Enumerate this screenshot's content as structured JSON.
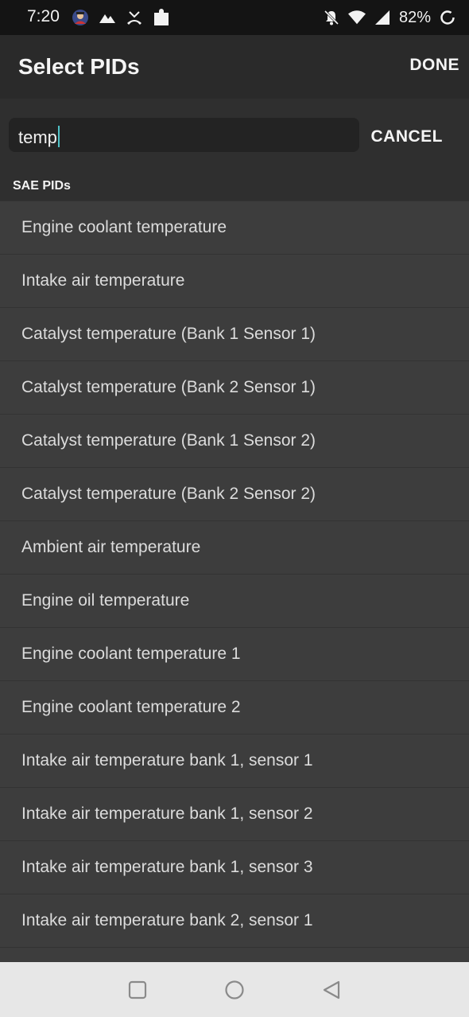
{
  "status_bar": {
    "time": "7:20",
    "battery": "82%",
    "icons_left": [
      "avatar-icon",
      "mountain-icon",
      "missed-call-icon",
      "puzzle-icon"
    ],
    "icons_right": [
      "mute-icon",
      "wifi-icon",
      "signal-icon",
      "battery-ring-icon"
    ]
  },
  "toolbar": {
    "title": "Select PIDs",
    "done_label": "DONE"
  },
  "search": {
    "value": "temp",
    "cancel_label": "CANCEL"
  },
  "section": {
    "header": "SAE PIDs"
  },
  "items": [
    {
      "label": "Engine coolant temperature"
    },
    {
      "label": "Intake air temperature"
    },
    {
      "label": "Catalyst temperature (Bank 1 Sensor 1)"
    },
    {
      "label": "Catalyst temperature (Bank 2 Sensor 1)"
    },
    {
      "label": "Catalyst temperature (Bank 1 Sensor 2)"
    },
    {
      "label": "Catalyst temperature (Bank 2 Sensor 2)"
    },
    {
      "label": "Ambient air temperature"
    },
    {
      "label": "Engine oil temperature"
    },
    {
      "label": "Engine coolant temperature 1"
    },
    {
      "label": "Engine coolant temperature 2"
    },
    {
      "label": "Intake air temperature bank 1, sensor 1"
    },
    {
      "label": "Intake air temperature bank 1, sensor 2"
    },
    {
      "label": "Intake air temperature bank 1, sensor 3"
    },
    {
      "label": "Intake air temperature bank 2, sensor 1"
    },
    {
      "label": ""
    }
  ],
  "nav": {
    "buttons": [
      "recents-square-icon",
      "home-circle-icon",
      "back-triangle-icon"
    ]
  }
}
